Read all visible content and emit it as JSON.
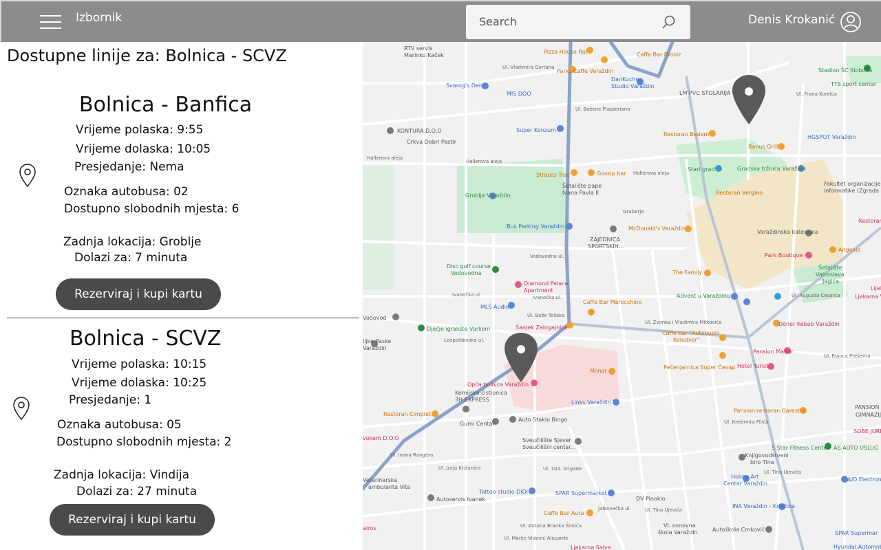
{
  "header": {
    "menu_label": "Izbornik",
    "search_placeholder": "Search",
    "user_name": "Denis Krokanić",
    "icons": {
      "menu": "hamburger-menu-icon",
      "search": "search-icon",
      "user": "user-account-icon"
    }
  },
  "panel": {
    "title": "Dostupne linije za: Bolnica - SCVZ",
    "cards": [
      {
        "route": "Bolnica - Banfica",
        "departure": "Vrijeme polaska: 9:55",
        "arrival": "Vrijeme dolaska: 10:05",
        "transfer": "Presjedanje: Nema",
        "bus_id": "Oznaka autobusa: 02",
        "seats": "Dostupno slobodnih mjesta: 6",
        "last_location": "Zadnja lokacija: Groblje",
        "arrives_in": "Dolazi za: 7 minuta",
        "button": "Rezerviraj i kupi kartu"
      },
      {
        "route": "Bolnica - SCVZ",
        "departure": "Vrijeme polaska: 10:15",
        "arrival": "Vrijeme dolaska: 10:25",
        "transfer": "Presjedanje: 1",
        "bus_id": "Oznaka autobusa: 05",
        "seats": "Dostupno slobodnih mjesta: 2",
        "last_location": "Zadnja lokacija: Vindija",
        "arrives_in": "Dolazi za: 27 minuta",
        "button": "Rezerviraj i kupi kartu"
      }
    ]
  },
  "map": {
    "pois": {
      "rtv": "RTV servis",
      "rtv2": "Marinko Kaček",
      "pizza": "Pizza House Raj",
      "caffe_dioniz": "Caffe Bar Dioniz",
      "parks": "Parks Caffe Varaždin",
      "dankuchen": "DanKuchen",
      "dankuchen2": "Studio Varaždin",
      "svarog": "Svarog's Den",
      "misdoo": "MIS DOO",
      "kontura": "KONTURA D.O.O",
      "crkva": "Crkva Dobri Pastir",
      "superkonzum": "Super Konzum",
      "stadion": "Stadion ŠC Sloboda",
      "tts": "TTS sport centar",
      "lmpvc": "LM PVC STOLARIJA",
      "bedem": "Restoran Bedem",
      "banus": "Banus Grill",
      "hgspot": "HGSPOT Varaždin",
      "starigrad": "Stari grad",
      "trznica": "Gradska tržnica Varaždin",
      "fakultet": "Fakultet organizacije i",
      "fakultet2": "informatike (Zgrada 2)",
      "strauss": "Strauss Tree",
      "gossip": "Gossip bar",
      "setaliste": "Šetalište pape",
      "setaliste2": "Ivana Pavla II",
      "groblje": "Groblje Varaždin",
      "vergleo": "Restoran Vergleo",
      "busparking": "Bus Parking Varaždin",
      "zajednica": "ZAJEDNICA",
      "zajednica2": "SPORTSKIH...",
      "mcdonalds": "McDonald's Varaždin",
      "katedrala": "Varaždinska katedrala",
      "restoranbe": "Restoran Be",
      "discgolf": "Disc golf course",
      "discgolf2": "Vodovodna",
      "diamond": "Diamond Palace",
      "diamond2": "Apartment",
      "parkboutique": "Park Boutique",
      "angelus": "Angelus",
      "setvat": "Šetalište",
      "setvat2": "Vatroslava",
      "setvat3": "Jagića",
      "thefamily": "The Family",
      "maroc": "Caffe Bar Marocchino",
      "advent": "Advent u Varaždinu",
      "mls": "MLS Audio",
      "lijek": "Lijek",
      "lijek2": "Ljekarna Vara",
      "vodovod": "Vodovod",
      "djecje": "Dječje igralište Varkom",
      "zalogajnica": "Šanjek Zalogajnica",
      "kolodvor": "Caffe bar \"Autobusni",
      "kolodvor2": "Kolodvor\"",
      "doner": "Döner Kebab Varaždin",
      "paske": "lijke Paske",
      "paske2": "Varaždin",
      "bolnica": "Opća bolnica Varaždin",
      "kemijska": "Kemijska čistionica",
      "kemijska2": "3H EXPRESS",
      "mlinar": "Mlinar",
      "pansionm": "Pansion Maltar",
      "hotelturist": "Hotel Turist",
      "cevap": "Pečenjarnica Super Ćevap",
      "links": "Links Varaždin",
      "cimplet": "Restoran Cimplet",
      "garestin": "Pansion-restoran Garestin",
      "autostaklo": "Auto Staklo Bingo",
      "gumicentar": "Gumi Centar",
      "pansprav": "PANSION PRAV",
      "gimnazija": "GIMNAZIJ",
      "sobe": "SOBE JURIN",
      "vokem": "vokem D.O.O",
      "sveuciliste": "Sveučilište Sjever",
      "sveuciliste2": "Sveučilišni centar...",
      "fivestar": "5 Star Fitness Center",
      "asauto": "AS AUTO USLUG",
      "veterinarska": "Veterinarska",
      "veterinarska2": "ambulanta Vita",
      "knjigo": "Knjigovodstveni",
      "knjigo2": "biro Tina",
      "hobbyart": "Hobby Art",
      "hobbyart2": "Centar Varaždin",
      "aedelectronic": "A/D Electronic",
      "tattoo": "Tattoo studio DiDi",
      "spar": "SPAR Supermarket",
      "dvpinokio": "DV Pinokio",
      "ivanek": "Autoservis Ivanek",
      "aura": "Caffe Bar Aura",
      "ina": "INA Varaždin - Kriežina",
      "osnovna": "VI. osnovna",
      "osnovna2": "škola Varaždin",
      "autoskola": "Autoškola Crnković",
      "spar2": "SPAR Supermar",
      "hyundai": "Hyundai Automobil",
      "lijekarnasalva": "Ljekarna Salva",
      "pairos": "airos"
    },
    "streets": {
      "gortana": "Ul. Vladimira Gortana",
      "hallerova1": "Hallerova aleja",
      "hallerova2": "Hallerova aleja",
      "hallerova3": "Hallerova aleja",
      "bozene": "Ul. Božene Plazzeriano",
      "kurelca": "Ul. Frana Kurelca",
      "graberje": "Graberje",
      "vodovodna": "Vodovodna ul.",
      "ivaneckal": "Ivanečka ul.",
      "ivanecka2": "Ivanečka ul.",
      "tezaka": "Ul. Bože Težaka",
      "milkovica": "Ul. Zvonka i Vladimira Milkovića",
      "augusta": "Ul. Augusta Cesarca",
      "presrerna": "Ul. Franca Prešerna",
      "leopold": "Leopoldovska ul.",
      "rangera": "Ul. Ivana Rangera",
      "krizanica": "Ul. Jurja Križanića",
      "brigade": "Ul. 104. brigade",
      "kresimira": "Ul. Krešimira Filića",
      "kreziva": "Ul. Tina Ujevića",
      "ujevica": "Ul. Tina Ujevića",
      "jalkoveeka": "Jalkovečka ul.",
      "brigade2": "Ul. Antuna Branka Šimića",
      "vidovic": "Ul. Marije Vidović Alecarde"
    }
  }
}
